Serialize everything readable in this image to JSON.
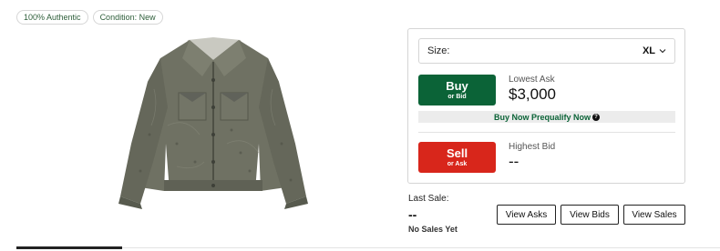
{
  "badges": [
    "100% Authentic",
    "Condition: New"
  ],
  "product": {
    "image_icon": "denim-jacket-image"
  },
  "size_selector": {
    "label": "Size:",
    "value": "XL",
    "icon": "chevron-down-icon"
  },
  "buy": {
    "label": "Buy",
    "sublabel": "or Bid",
    "price_label": "Lowest Ask",
    "price": "$3,000",
    "color": "#0b6337"
  },
  "prequalify": {
    "label": "Buy Now Prequalify Now",
    "icon": "question-icon"
  },
  "sell": {
    "label": "Sell",
    "sublabel": "or Ask",
    "price_label": "Highest Bid",
    "price": "--",
    "color": "#d8261b"
  },
  "last_sale": {
    "label": "Last Sale:",
    "value": "--",
    "note": "No Sales Yet"
  },
  "view_buttons": {
    "asks": "View Asks",
    "bids": "View Bids",
    "sales": "View Sales"
  }
}
